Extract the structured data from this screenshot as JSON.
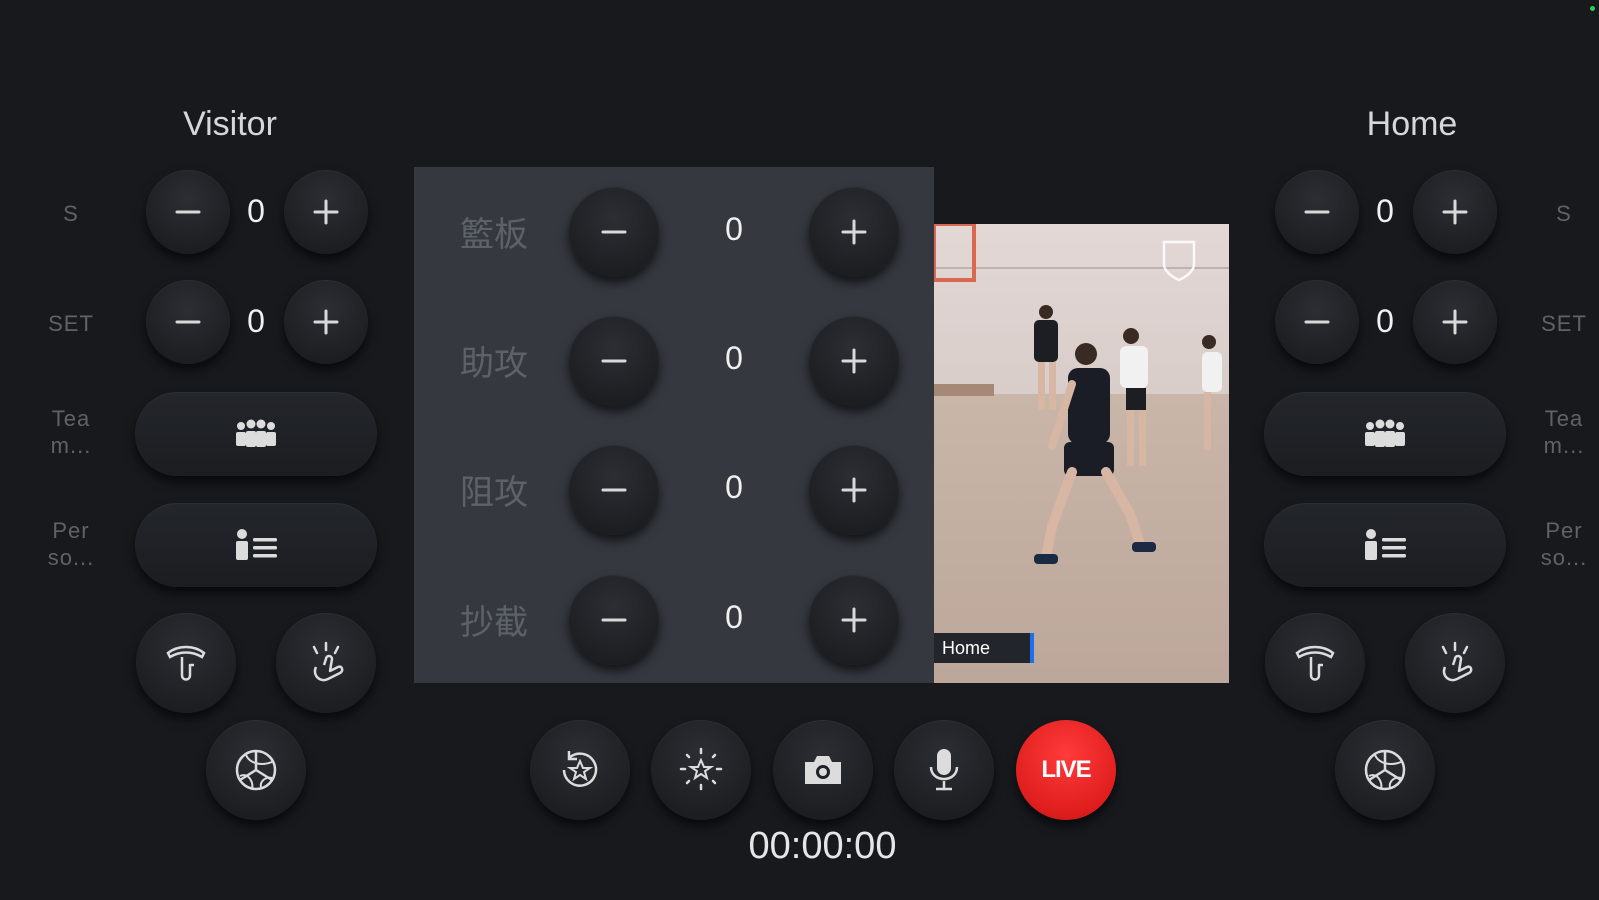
{
  "visitor": {
    "title": "Visitor",
    "score_label": "S",
    "score": "0",
    "set_label": "SET",
    "set": "0",
    "team_label": "Tea\nm...",
    "person_label": "Per\nso..."
  },
  "home": {
    "title": "Home",
    "score_label": "S",
    "score": "0",
    "set_label": "SET",
    "set": "0",
    "team_label": "Tea\nm...",
    "person_label": "Per\nso..."
  },
  "stats": [
    {
      "label": "籃板",
      "value": "0"
    },
    {
      "label": "助攻",
      "value": "0"
    },
    {
      "label": "阻攻",
      "value": "0"
    },
    {
      "label": "抄截",
      "value": "0"
    }
  ],
  "preview": {
    "overlay_label": "Home"
  },
  "controls": {
    "live_label": "LIVE",
    "timer": "00:00:00"
  },
  "icons": [
    "minus-icon",
    "plus-icon",
    "team-icon",
    "person-list-icon",
    "pick-icon",
    "tap-icon",
    "volleyball-icon",
    "replay-star-icon",
    "highlight-icon",
    "camera-icon",
    "mic-icon"
  ],
  "colors": {
    "background": "#17191d",
    "panel": "#35393f",
    "live": "#e8201f",
    "overlay_accent": "#1e6ff0"
  }
}
